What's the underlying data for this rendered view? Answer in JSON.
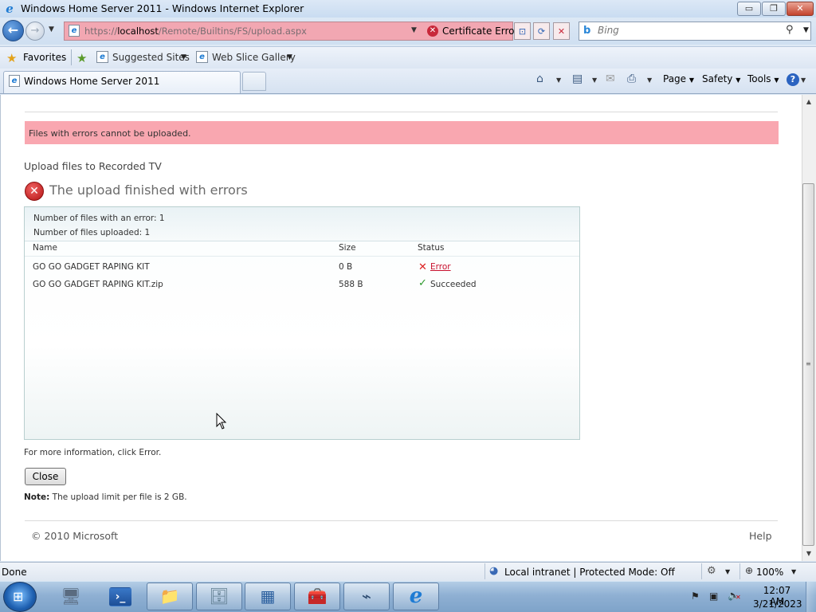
{
  "window": {
    "title": "Windows Home Server 2011 - Windows Internet Explorer",
    "minimize": "▭",
    "maximize": "❐",
    "close": "✕"
  },
  "navigation": {
    "address_prefix": "https://",
    "address_host": "localhost",
    "address_path": "/Remote/Builtins/FS/upload.aspx",
    "certificate_error": "Certificate Error",
    "search_placeholder": "Bing"
  },
  "favorites_bar": {
    "favorites_label": "Favorites",
    "suggested_sites": "Suggested Sites",
    "web_slice_gallery": "Web Slice Gallery"
  },
  "tabs": [
    {
      "label": "Windows Home Server 2011",
      "active": true
    }
  ],
  "command_bar": {
    "page": "Page",
    "safety": "Safety",
    "tools": "Tools"
  },
  "page": {
    "error_banner": "Files with errors cannot be uploaded.",
    "heading": "Upload files to Recorded TV",
    "status_title": "The upload finished with errors",
    "summary": {
      "errors": "Number of files with an error: 1",
      "uploaded": "Number of files uploaded: 1"
    },
    "columns": [
      "Name",
      "Size",
      "Status"
    ],
    "rows": [
      {
        "name": "GO GO GADGET RAPING KIT",
        "size": "0 B",
        "status": "Error",
        "status_type": "error"
      },
      {
        "name": "GO GO GADGET RAPING KIT.zip",
        "size": "588 B",
        "status": "Succeeded",
        "status_type": "success"
      }
    ],
    "more_info": "For more information, click Error.",
    "close_button": "Close",
    "note_label": "Note:",
    "note_text": " The upload limit per file is 2 GB.",
    "copyright": "© 2010 Microsoft",
    "help": "Help"
  },
  "status_bar": {
    "status": "Done",
    "zone": "Local intranet | Protected Mode: Off",
    "zoom": "100%"
  },
  "taskbar": {
    "clock_time": "12:07 AM",
    "clock_date": "3/21/2023",
    "items": [
      {
        "name": "server-manager",
        "icon": "🖥"
      },
      {
        "name": "powershell",
        "icon": "›_"
      },
      {
        "name": "windows-explorer",
        "icon": "📁"
      },
      {
        "name": "backup-tool",
        "icon": "🗄"
      },
      {
        "name": "dashboard",
        "icon": "▦"
      },
      {
        "name": "toolbox",
        "icon": "🧰"
      },
      {
        "name": "network-tool",
        "icon": "⌁"
      },
      {
        "name": "internet-explorer",
        "icon": "e"
      }
    ]
  },
  "colors": {
    "error_banner": "#f9a7b0",
    "error_text": "#c8102e",
    "success": "#2d9a2d",
    "address_bar_error": "#f2a7b2"
  }
}
